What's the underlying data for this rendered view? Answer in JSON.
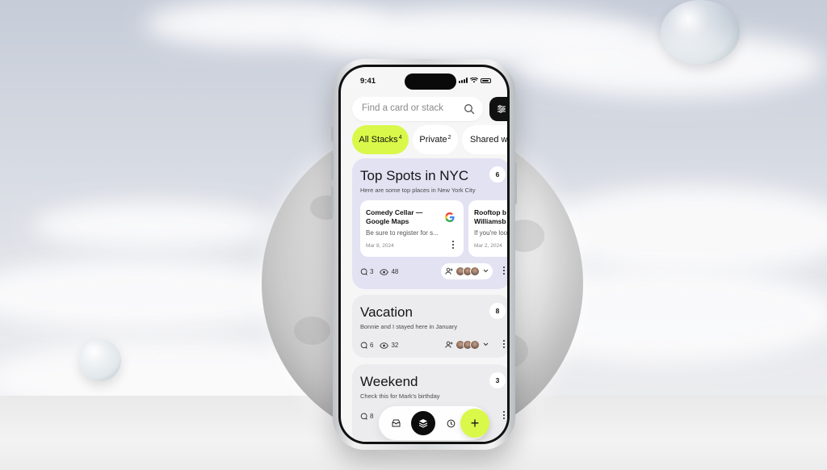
{
  "status": {
    "time": "9:41"
  },
  "search": {
    "placeholder": "Find a card or stack"
  },
  "chips": [
    {
      "label": "All Stacks",
      "count": "4"
    },
    {
      "label": "Private",
      "count": "2"
    },
    {
      "label": "Shared with",
      "count": ""
    }
  ],
  "stacks": [
    {
      "title": "Top Spots in NYC",
      "subtitle": "Here are some top places in New York City",
      "count": "6",
      "comments": "3",
      "views": "48",
      "cards": [
        {
          "title_line1": "Comedy Cellar —",
          "title_line2": "Google Maps",
          "desc": "Be sure to register for s...",
          "date": "Mar 8, 2024"
        },
        {
          "title_line1": "Rooftop b",
          "title_line2": "Williamsb",
          "desc": "If you're loo",
          "date": "Mar 2, 2024"
        }
      ]
    },
    {
      "title": "Vacation",
      "subtitle": "Bonnie and I stayed here in January",
      "count": "8",
      "comments": "6",
      "views": "32"
    },
    {
      "title": "Weekend",
      "subtitle": "Check this for Mark's birthday",
      "count": "3",
      "comments": "8"
    }
  ],
  "fab": {
    "label": "+"
  },
  "colors": {
    "accent": "#d9f84a",
    "dark": "#0d0d0d",
    "stack_highlight": "#e3e2f3"
  }
}
